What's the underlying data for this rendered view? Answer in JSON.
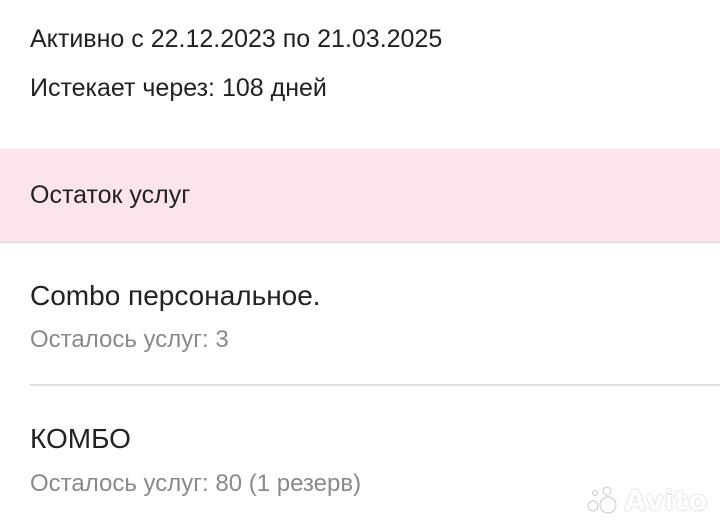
{
  "subscription": {
    "active_range": "Активно с 22.12.2023 по 21.03.2025",
    "expires_in": "Истекает через: 108 дней"
  },
  "section": {
    "title": "Остаток услуг",
    "background_color": "#fce4ec"
  },
  "services": [
    {
      "name": "Combo персональное.",
      "remaining": "Осталось услуг: 3"
    },
    {
      "name": "КОМБО",
      "remaining": "Осталось услуг: 80 (1 резерв)"
    }
  ],
  "watermark": {
    "text": "Avito",
    "icon": "avito-logo-icon"
  }
}
